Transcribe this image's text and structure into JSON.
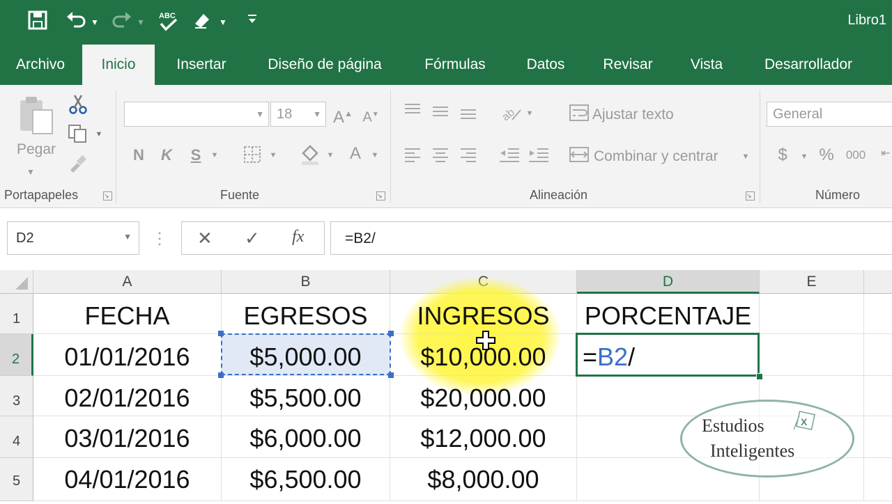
{
  "window": {
    "title": "Libro1",
    "quick_access": [
      "save-icon",
      "undo-icon",
      "redo-icon",
      "spelling-icon",
      "touch-mode-icon",
      "customize-icon"
    ],
    "theme_color": "#217346"
  },
  "tabs": [
    "Archivo",
    "Inicio",
    "Insertar",
    "Diseño de página",
    "Fórmulas",
    "Datos",
    "Revisar",
    "Vista",
    "Desarrollador"
  ],
  "active_tab": "Inicio",
  "ribbon": {
    "clipboard": {
      "paste_label": "Pegar",
      "group_label": "Portapapeles"
    },
    "font": {
      "group_label": "Fuente",
      "font_name": "",
      "font_size": "18",
      "bold": "N",
      "italic": "K",
      "underline": "S",
      "grow": "A",
      "shrink": "A",
      "font_color": "A"
    },
    "alignment": {
      "group_label": "Alineación",
      "wrap_text": "Ajustar texto",
      "merge_center": "Combinar y centrar"
    },
    "number": {
      "group_label": "Número",
      "format": "General",
      "currency": "$",
      "percent": "%",
      "thousands": "000"
    }
  },
  "formula_bar": {
    "name_box": "D2",
    "cancel": "✕",
    "enter": "✓",
    "fx": "fx",
    "formula": "=B2/"
  },
  "sheet": {
    "columns": [
      "A",
      "B",
      "C",
      "D",
      "E"
    ],
    "selected_column": "D",
    "rows": [
      "1",
      "2",
      "3",
      "4",
      "5"
    ],
    "selected_row": "2",
    "header_row": [
      "FECHA",
      "EGRESOS",
      "INGRESOS",
      "PORCENTAJE"
    ],
    "data": [
      [
        "01/01/2016",
        "$5,000.00",
        "$10,000.00"
      ],
      [
        "02/01/2016",
        "$5,500.00",
        "$20,000.00"
      ],
      [
        "03/01/2016",
        "$6,000.00",
        "$12,000.00"
      ],
      [
        "04/01/2016",
        "$6,500.00",
        "$8,000.00"
      ]
    ],
    "active_cell": {
      "eq": "=",
      "ref": "B2",
      "op": "/"
    },
    "ref_color": "#3b6fc9"
  },
  "watermark": {
    "line1": "Estudios",
    "line2": "Inteligentes"
  }
}
